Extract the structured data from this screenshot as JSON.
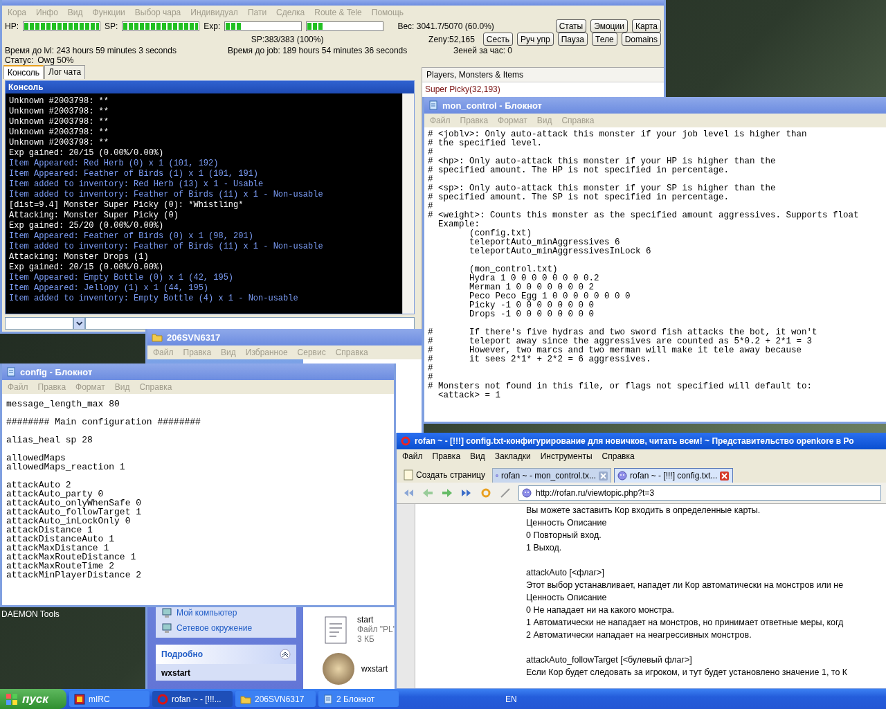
{
  "main_window": {
    "menu": [
      "Кора",
      "Инфо",
      "Вид",
      "Функции",
      "Выбор чара",
      "Индивидуал",
      "Пати",
      "Сделка",
      "Route & Tele",
      "Помощь"
    ],
    "meters": [
      {
        "label": "HP:",
        "level": 1
      },
      {
        "label": "SP:",
        "level": 1
      },
      {
        "label": "Exp:",
        "level": 0.2
      },
      {
        "level": 0.2
      }
    ],
    "weight": "Вес: 3041.7/5070 (60.0%)",
    "buttons_row1": [
      "Статы",
      "Эмоции",
      "Карта"
    ],
    "sp": "SP:383/383 (100%)",
    "zeny": "Zeny:52,165",
    "buttons_row2": [
      "Сесть",
      "Руч упр",
      "Пауза",
      "Теле",
      "Domains"
    ],
    "time_lvl": "Время до lvl: 243 hours 59 minutes 3 seconds",
    "time_job": "Время до job: 189 hours 54 minutes 36 seconds",
    "zeny_rate": "Зеней за час: 0",
    "status_label": "Статус:",
    "status_value": "Owg 50%",
    "tabs": [
      {
        "label": "Консоль",
        "selected": true
      },
      {
        "label": "Лог чата",
        "selected": false
      }
    ],
    "console_title": "Консоль",
    "console_lines": [
      {
        "kind": "event",
        "text": "Unknown #2003798: **"
      },
      {
        "kind": "event",
        "text": "Unknown #2003798: **"
      },
      {
        "kind": "event",
        "text": "Unknown #2003798: **"
      },
      {
        "kind": "event",
        "text": "Unknown #2003798: **"
      },
      {
        "kind": "event",
        "text": "Unknown #2003798: **"
      },
      {
        "kind": "event",
        "text": "Exp gained: 20/15 (0.00%/0.00%)"
      },
      {
        "kind": "item",
        "text": "Item Appeared: Red Herb (0) x 1 (101, 192)"
      },
      {
        "kind": "item",
        "text": "Item Appeared: Feather of Birds (1) x 1 (101, 191)"
      },
      {
        "kind": "item",
        "text": "Item added to inventory: Red Herb (13) x 1 - Usable"
      },
      {
        "kind": "item",
        "text": "Item added to inventory: Feather of Birds (11) x 1 - Non-usable"
      },
      {
        "kind": "event",
        "text": "[dist=9.4] Monster Super Picky (0): *Whistling*"
      },
      {
        "kind": "event",
        "text": "Attacking: Monster Super Picky (0)"
      },
      {
        "kind": "event",
        "text": "Exp gained: 25/20 (0.00%/0.00%)"
      },
      {
        "kind": "item",
        "text": "Item Appeared: Feather of Birds (0) x 1 (98, 201)"
      },
      {
        "kind": "item",
        "text": "Item added to inventory: Feather of Birds (11) x 1 - Non-usable"
      },
      {
        "kind": "event",
        "text": "Attacking: Monster Drops (1)"
      },
      {
        "kind": "event",
        "text": "Exp gained: 20/15 (0.00%/0.00%)"
      },
      {
        "kind": "item",
        "text": "Item Appeared: Empty Bottle (0) x 1 (42, 195)"
      },
      {
        "kind": "item",
        "text": "Item Appeared: Jellopy (1) x 1 (44, 195)"
      },
      {
        "kind": "item",
        "text": "Item added to inventory: Empty Bottle (4) x 1 - Non-usable"
      }
    ],
    "side_panel": {
      "title": "Players, Monsters & Items",
      "items": [
        "Super Picky(32,193)"
      ]
    }
  },
  "explorer": {
    "title": "206SVN6317",
    "menu": [
      "Файл",
      "Правка",
      "Вид",
      "Избранное",
      "Сервис",
      "Справка"
    ],
    "places": [
      "Мой компьютер",
      "Сетевое окружение"
    ],
    "details_title": "Подробно",
    "details_name": "wxstart",
    "files": [
      {
        "kind": "document",
        "name": "start",
        "type": "Файл \"PL\"",
        "size": "3 КБ"
      },
      {
        "kind": "picture",
        "name": "wxstart"
      }
    ]
  },
  "config": {
    "title": "config - Блокнот",
    "menu": [
      "Файл",
      "Правка",
      "Формат",
      "Вид",
      "Справка"
    ],
    "content": "message_length_max 80\n\n######## Main configuration ########\n\nalias_heal sp 28\n\nallowedMaps\nallowedMaps_reaction 1\n\nattackAuto 2\nattackAuto_party 0\nattackAuto_onlyWhenSafe 0\nattackAuto_followTarget 1\nattackAuto_inLockOnly 0\nattackDistance 1\nattackDistanceAuto 1\nattackMaxDistance 1\nattackMaxRouteDistance 1\nattackMaxRouteTime 2\nattackMinPlayerDistance 2"
  },
  "mon_control": {
    "title": "mon_control - Блокнот",
    "menu": [
      "Файл",
      "Правка",
      "Формат",
      "Вид",
      "Справка"
    ],
    "content": "# <joblv>: Only auto-attack this monster if your job level is higher than\n# the specified level.\n#\n# <hp>: Only auto-attack this monster if your HP is higher than the\n# specified amount. The HP is not specified in percentage.\n#\n# <sp>: Only auto-attack this monster if your SP is higher than the\n# specified amount. The SP is not specified in percentage.\n#\n# <weight>: Counts this monster as the specified amount aggressives. Supports float\n  Example:\n        (config.txt)\n        teleportAuto_minAggressives 6\n        teleportAuto_minAggressivesInLock 6\n\n        (mon_control.txt)\n        Hydra 1 0 0 0 0 0 0 0 0.2\n        Merman 1 0 0 0 0 0 0 0 2\n        Peco Peco Egg 1 0 0 0 0 0 0 0 0\n        Picky -1 0 0 0 0 0 0 0 0\n        Drops -1 0 0 0 0 0 0 0 0\n\n#       If there's five hydras and two sword fish attacks the bot, it won't\n#       teleport away since the aggressives are counted as 5*0.2 + 2*1 = 3\n#       However, two marcs and two merman will make it tele away because\n#       it sees 2*1* + 2*2 = 6 aggressives.\n#\n#\n# Monsters not found in this file, or flags not specified will default to:\n  <attack> = 1"
  },
  "browser": {
    "title": "rofan ~ - [!!!] config.txt-конфигурирование для новичков, читать всем! ~ Представительство openkore в Ро",
    "menu": [
      "Файл",
      "Правка",
      "Вид",
      "Закладки",
      "Инструменты",
      "Справка"
    ],
    "new_page": "Создать страницу",
    "tabs": [
      {
        "label": "rofan ~ - mon_control.tx...",
        "selected": false
      },
      {
        "label": "rofan ~ - [!!!] config.txt...",
        "selected": true
      }
    ],
    "url": "http://rofan.ru/viewtopic.php?t=3",
    "blocks": [
      {
        "lines": [
          "Вы можете заставить Кор входить в определенные карты.",
          "Ценность Описание",
          "0 Повторный вход.",
          "1 Выход."
        ]
      },
      {
        "lines": [
          "attackAuto [<флаг>]",
          "Этот выбор устанавливает, нападет ли Кор автоматически на монстров или не",
          "Ценность Описание",
          "0 Не нападает ни на какого монстра.",
          "1 Автоматически не нападает на монстров, но принимает ответные меры, когд",
          "2 Автоматически нападает на неагрессивных монстров."
        ]
      },
      {
        "lines": [
          "attackAuto_followTarget [<булевый флаг>]",
          "Если Кор будет следовать за игроком, и тут будет установлено значение 1, то К"
        ]
      }
    ]
  },
  "desktop_icons": [
    {
      "label": "DAEMON Tools"
    }
  ],
  "taskbar": {
    "start": "пуск",
    "items": [
      {
        "kind": "irc",
        "label": "mIRC",
        "selected": false
      },
      {
        "kind": "browser",
        "label": "rofan ~ - [!!!...",
        "selected": true
      },
      {
        "kind": "folder",
        "label": "206SVN6317",
        "selected": false
      },
      {
        "kind": "notepad",
        "label": "2 Блокнот",
        "selected": false
      }
    ],
    "language": "EN"
  }
}
